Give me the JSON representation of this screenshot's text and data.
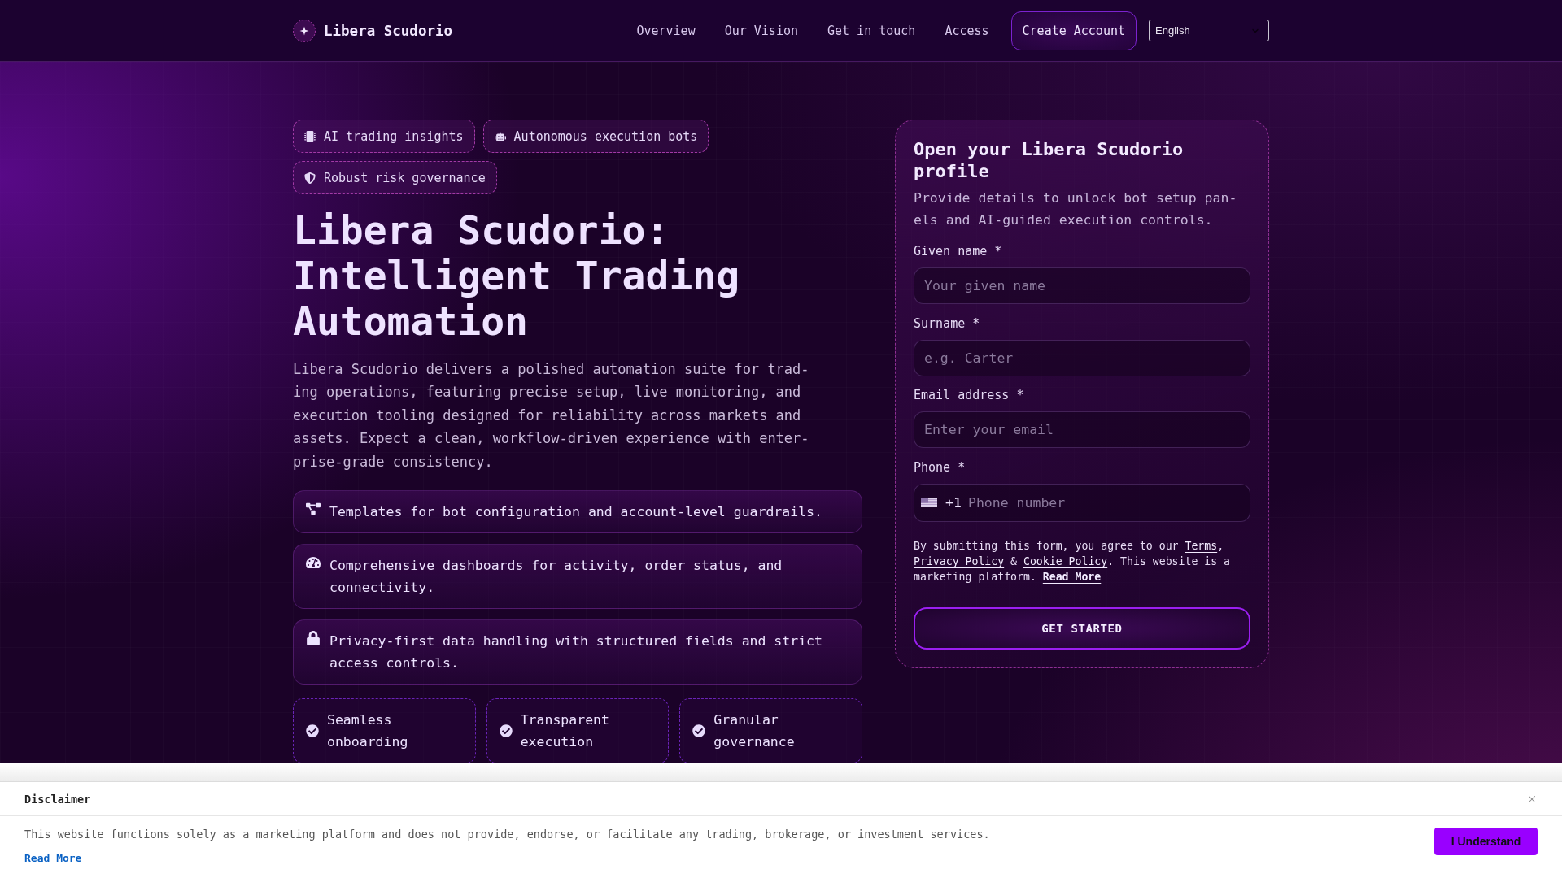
{
  "header": {
    "brand": "Libera Scudorio",
    "nav": [
      "Overview",
      "Our Vision",
      "Get in touch",
      "Access"
    ],
    "cta": "Create Account",
    "language": "English"
  },
  "hero": {
    "tags": [
      {
        "kind": "chip",
        "label": "AI trading insights"
      },
      {
        "kind": "robot",
        "label": "Autonomous execution bots"
      },
      {
        "kind": "shield",
        "label": "Robust risk governance"
      }
    ],
    "title": "Libera Scudorio: Intelligent Trading Automation",
    "description": "Libera Scudorio delivers a polished automation suite for trad-ing operations, featuring precise setup, live monitoring, and execution tooling designed for reliability across markets and assets. Expect a clean, workflow-driven experience with enter-prise-grade consistency.",
    "features": [
      {
        "kind": "diagram",
        "text": "Templates for bot configuration and account-level guardrails."
      },
      {
        "kind": "gauge",
        "text": "Comprehensive dashboards for activity, order status, and connectivity."
      },
      {
        "kind": "lock",
        "text": "Privacy-first data handling with structured fields and strict access controls."
      }
    ],
    "highlights": [
      "Seamless onboarding",
      "Transparent execution",
      "Granular governance"
    ]
  },
  "signup": {
    "title": "Open your Libera Scudorio profile",
    "subtitle": "Provide details to unlock bot setup pan-els and AI-guided execution controls.",
    "fields": [
      {
        "kind": "text",
        "label": "Given name *",
        "placeholder": "Your given name"
      },
      {
        "kind": "text",
        "label": "Surname *",
        "placeholder": "e.g. Carter"
      },
      {
        "kind": "email",
        "label": "Email address *",
        "placeholder": "Enter your email"
      },
      {
        "kind": "phone",
        "label": "Phone *",
        "country_code": "+1",
        "placeholder": "Phone number"
      }
    ],
    "consent": [
      {
        "kind": "text",
        "text": "By submitting this form, you agree to our "
      },
      {
        "kind": "link",
        "text": "Terms"
      },
      {
        "kind": "text",
        "text": ", "
      },
      {
        "kind": "link",
        "text": "Privacy Policy"
      },
      {
        "kind": "text",
        "text": " & "
      },
      {
        "kind": "link",
        "text": "Cookie Policy"
      },
      {
        "kind": "text",
        "text": ". This website is a marketing platform. "
      },
      {
        "kind": "strong_link",
        "text": "Read More"
      }
    ],
    "submit": "GET STARTED"
  },
  "disclaimer": {
    "title": "Disclaimer",
    "text": "This website functions solely as a marketing platform and does not provide, endorse, or facilitate any trading, brokerage, or investment services.",
    "link": "Read More",
    "button": "I Understand"
  }
}
